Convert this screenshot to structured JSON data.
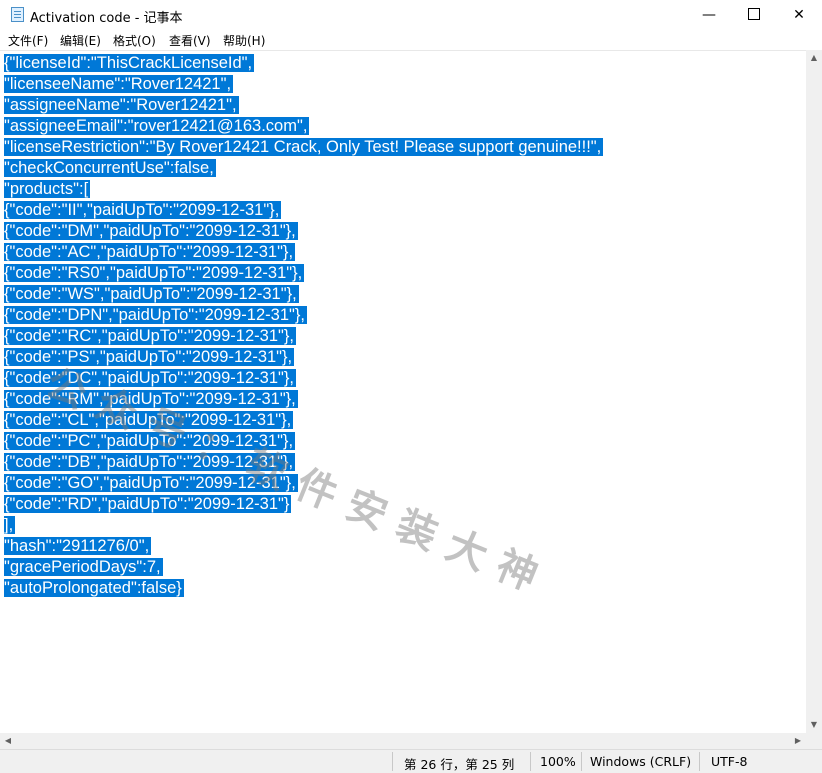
{
  "window": {
    "title": "Activation code - 记事本",
    "minimize_glyph": "—",
    "close_glyph": "✕"
  },
  "menu": [
    "文件(F)",
    "编辑(E)",
    "格式(O)",
    "查看(V)",
    "帮助(H)"
  ],
  "editor": {
    "lines": [
      "{\"licenseId\":\"ThisCrackLicenseId\",",
      "\"licenseeName\":\"Rover12421\",",
      "\"assigneeName\":\"Rover12421\",",
      "\"assigneeEmail\":\"rover12421@163.com\",",
      "\"licenseRestriction\":\"By Rover12421 Crack, Only Test! Please support genuine!!!\",",
      "\"checkConcurrentUse\":false,",
      "\"products\":[",
      "{\"code\":\"II\",\"paidUpTo\":\"2099-12-31\"},",
      "{\"code\":\"DM\",\"paidUpTo\":\"2099-12-31\"},",
      "{\"code\":\"AC\",\"paidUpTo\":\"2099-12-31\"},",
      "{\"code\":\"RS0\",\"paidUpTo\":\"2099-12-31\"},",
      "{\"code\":\"WS\",\"paidUpTo\":\"2099-12-31\"},",
      "{\"code\":\"DPN\",\"paidUpTo\":\"2099-12-31\"},",
      "{\"code\":\"RC\",\"paidUpTo\":\"2099-12-31\"},",
      "{\"code\":\"PS\",\"paidUpTo\":\"2099-12-31\"},",
      "{\"code\":\"DC\",\"paidUpTo\":\"2099-12-31\"},",
      "{\"code\":\"RM\",\"paidUpTo\":\"2099-12-31\"},",
      "{\"code\":\"CL\",\"paidUpTo\":\"2099-12-31\"},",
      "{\"code\":\"PC\",\"paidUpTo\":\"2099-12-31\"},",
      "{\"code\":\"DB\",\"paidUpTo\":\"2099-12-31\"},",
      "{\"code\":\"GO\",\"paidUpTo\":\"2099-12-31\"},",
      "{\"code\":\"RD\",\"paidUpTo\":\"2099-12-31\"}",
      "],",
      "\"hash\":\"2911276/0\",",
      "\"gracePeriodDays\":7,",
      "\"autoProlongated\":false}"
    ],
    "selection_color": "#0078d7",
    "watermark": "公众号：软件安装大神"
  },
  "statusbar": {
    "position": "第 26 行，第 25 列",
    "zoom": "100%",
    "line_ending": "Windows (CRLF)",
    "encoding": "UTF-8"
  }
}
